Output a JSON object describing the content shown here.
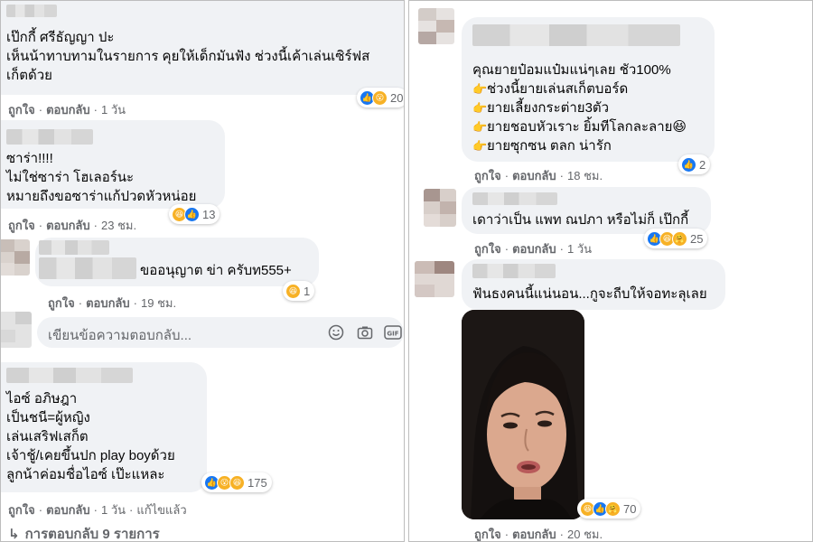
{
  "comments_left": [
    {
      "name_hidden": true,
      "lines": [
        "เป๊กกี้ ศรีธัญญา ปะ",
        "เห็นน้าทาบทามในรายการ คุยให้เด็กมันฟัง ช่วงนี้เค้าเล่นเซิร์ฟส",
        "เก็ตด้วย"
      ],
      "like": "ถูกใจ",
      "reply": "ตอบกลับ",
      "time": "1 วัน",
      "reactions": [
        "like",
        "wow"
      ],
      "count": "20"
    },
    {
      "lines": [
        "ซาร่า!!!!",
        "ไม่ใช่ซาร่า โฮเลอร์นะ",
        "หมายถึงขอซาร่าแก้ปวดหัวหน่อย"
      ],
      "like": "ถูกใจ",
      "reply": "ตอบกลับ",
      "time": "23 ชม.",
      "reactions": [
        "haha",
        "like"
      ],
      "count": "13"
    },
    {
      "lines": [
        "ขออนุญาต ข่า ครับท555+"
      ],
      "like": "ถูกใจ",
      "reply": "ตอบกลับ",
      "time": "19 ชม.",
      "reactions": [
        "haha"
      ],
      "count": "1"
    },
    {
      "lines": [
        "ไอซ์ อภิษฎา",
        "เป็นชนี=ผู้หญิง",
        "เล่นเสริฟเสก็ต",
        "เจ้าชู้/เคยขึ้นปก play boyด้วย",
        "ลูกน้าค่อมชื่อไอซ์ เป๊ะแหละ"
      ],
      "like": "ถูกใจ",
      "reply": "ตอบกลับ",
      "time": "1 วัน",
      "edited": "แก้ไขแล้ว",
      "reactions": [
        "like",
        "wow",
        "haha"
      ],
      "count": "175"
    }
  ],
  "reply_box": {
    "placeholder": "เขียนข้อความตอบกลับ..."
  },
  "view_replies": "การตอบกลับ 9 รายการ",
  "comments_right": [
    {
      "lines": [
        "คุณยายป๋อมแป๋มแน่ๆเลย ชัว100%",
        "ช่วงนี้ยายเล่นสเก็ตบอร์ด",
        "ยายเลี้ยงกระต่าย3ตัว",
        "ยายชอบหัวเราะ ยิ้มทีโลกละลาย",
        "ยายซุกซน ตลก น่ารัก"
      ],
      "bullet_emoji": "👉",
      "like": "ถูกใจ",
      "reply": "ตอบกลับ",
      "time": "18 ชม.",
      "reactions": [
        "like"
      ],
      "count": "2"
    },
    {
      "lines": [
        "เดาว่าเป็น แพท ณปภา หรือไม่ก็ เป๊กกี้"
      ],
      "like": "ถูกใจ",
      "reply": "ตอบกลับ",
      "time": "1 วัน",
      "reactions": [
        "like",
        "haha",
        "care"
      ],
      "count": "25"
    },
    {
      "lines": [
        "ฟันธงคนนี้แน่นอน...กูจะถีบให้จอทะลุเลย"
      ],
      "like": "ถูกใจ",
      "reply": "ตอบกลับ",
      "time": "20 ชม.",
      "reactions": [
        "haha",
        "like",
        "care"
      ],
      "count": "70"
    }
  ],
  "colors": {
    "bubble": "#f0f2f5",
    "meta": "#65676b",
    "like_blue": "#1877f2",
    "haha_yellow": "#f7b125"
  }
}
